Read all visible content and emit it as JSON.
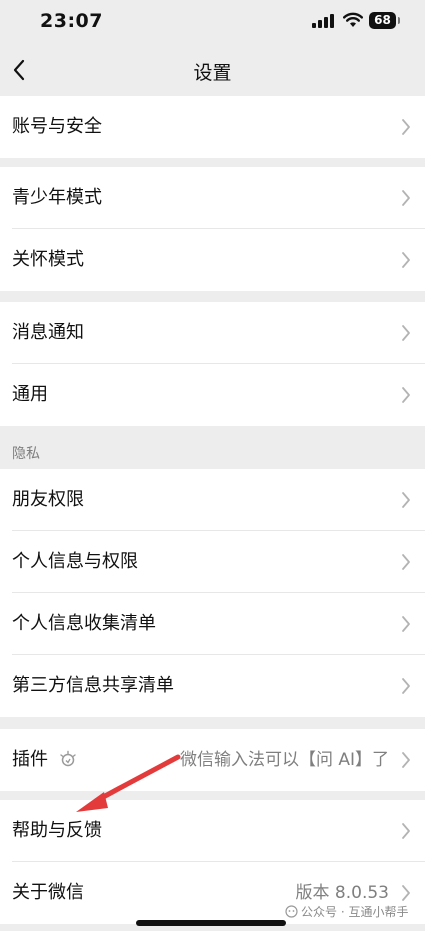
{
  "status_bar": {
    "time": "23:07",
    "battery": "68"
  },
  "header": {
    "title": "设置"
  },
  "groups": {
    "account": {
      "label": "账号与安全"
    },
    "youth": {
      "label": "青少年模式"
    },
    "care": {
      "label": "关怀模式"
    },
    "notify": {
      "label": "消息通知"
    },
    "general": {
      "label": "通用"
    },
    "privacy_header": "隐私",
    "friends": {
      "label": "朋友权限"
    },
    "personal": {
      "label": "个人信息与权限"
    },
    "collect": {
      "label": "个人信息收集清单"
    },
    "thirdparty": {
      "label": "第三方信息共享清单"
    },
    "plugins": {
      "label": "插件",
      "value": "微信输入法可以【问 AI】了"
    },
    "help": {
      "label": "帮助与反馈"
    },
    "about": {
      "label": "关于微信",
      "value": "版本 8.0.53"
    }
  },
  "watermark": "公众号 · 互通小帮手",
  "colors": {
    "background": "#ededed",
    "annotation_arrow": "#e33b3b"
  }
}
